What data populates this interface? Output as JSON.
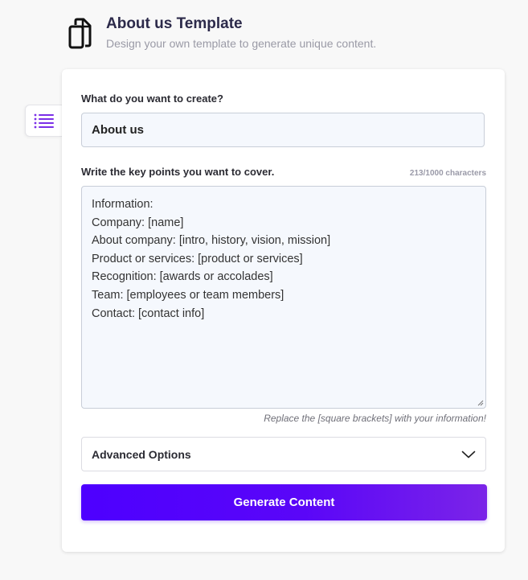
{
  "header": {
    "icon": "copy-documents-icon",
    "title": "About us Template",
    "subtitle": "Design your own template to generate unique content."
  },
  "sidebar_tab": {
    "icon": "list-icon",
    "accent_color": "#7b2fe8"
  },
  "form": {
    "create_label": "What do you want to create?",
    "create_value": "About us",
    "keypoints_label": "Write the key points you want to cover.",
    "char_counter": "213/1000 characters",
    "keypoints_lines": [
      "Information:",
      "Company: [name]",
      "About company: [intro, history, vision, mission]",
      "Product or services: [product or services]",
      "Recognition: [awards or accolades]",
      "Team: [employees or team members]",
      "Contact: [contact info]"
    ],
    "hint": "Replace the [square brackets] with your information!",
    "advanced_label": "Advanced Options",
    "advanced_icon": "chevron-down-icon",
    "generate_label": "Generate Content"
  },
  "colors": {
    "button_gradient_start": "#4d00ff",
    "button_gradient_end": "#7b24e8",
    "field_background": "#f5f8fd"
  }
}
